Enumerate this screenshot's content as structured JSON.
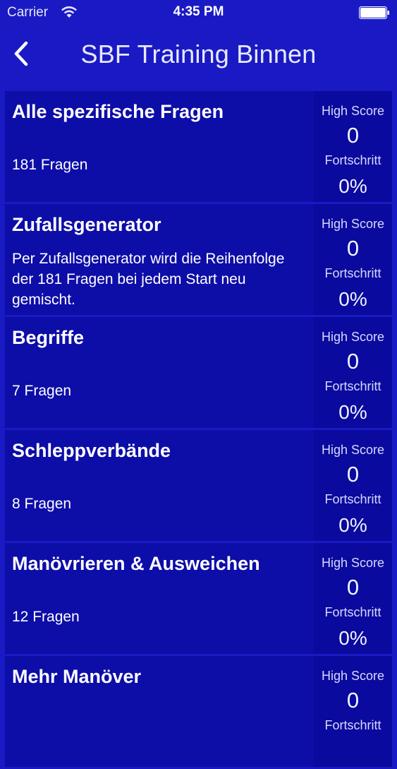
{
  "status_bar": {
    "carrier": "Carrier",
    "time": "4:35 PM"
  },
  "nav": {
    "title": "SBF Training Binnen",
    "back_icon": "chevron-left-icon"
  },
  "labels": {
    "high_score": "High Score",
    "progress": "Fortschritt"
  },
  "rows": [
    {
      "title": "Alle spezifische Fragen",
      "description": "181 Fragen",
      "high_score": "0",
      "progress": "0%"
    },
    {
      "title": "Zufallsgenerator",
      "description": "Per Zufallsgenerator wird die Reihenfolge der 181 Fragen bei jedem Start neu gemischt.",
      "high_score": "0",
      "progress": "0%"
    },
    {
      "title": "Begriffe",
      "description": "7 Fragen",
      "high_score": "0",
      "progress": "0%"
    },
    {
      "title": "Schleppverbände",
      "description": "8 Fragen",
      "high_score": "0",
      "progress": "0%"
    },
    {
      "title": "Manövrieren & Ausweichen",
      "description": "12 Fragen",
      "high_score": "0",
      "progress": "0%"
    },
    {
      "title": "Mehr Manöver",
      "description": "",
      "high_score": "0",
      "progress": ""
    }
  ],
  "colors": {
    "background": "#1a1ac4",
    "row_background": "#0d0da8",
    "score_panel": "#0a0a9e",
    "text": "#ffffff"
  }
}
